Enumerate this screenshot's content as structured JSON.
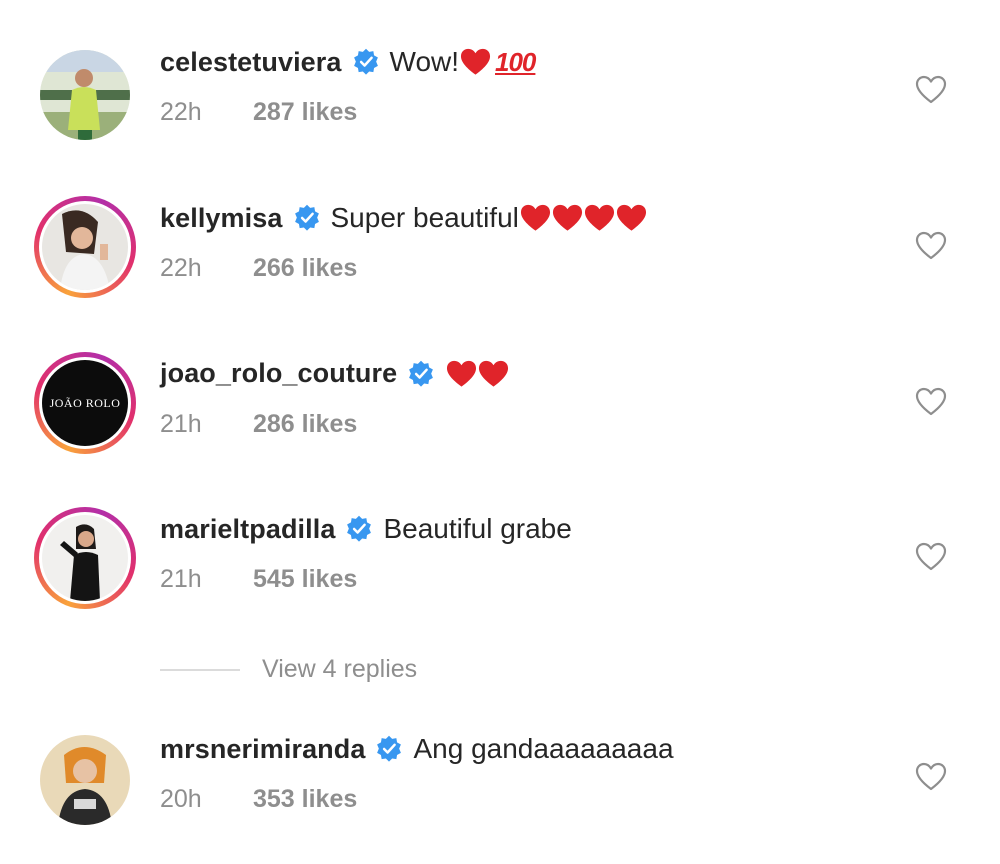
{
  "comments": [
    {
      "username": "celestetuviera",
      "text": "Wow! ",
      "emoji": [
        "heart"
      ],
      "extra": "100",
      "time": "22h",
      "likes": "287 likes"
    },
    {
      "username": "kellymisa",
      "text": "Super beautiful ",
      "emoji": [
        "heart",
        "heart",
        "heart",
        "heart"
      ],
      "time": "22h",
      "likes": "266 likes"
    },
    {
      "username": "joao_rolo_couture",
      "text": "",
      "emoji": [
        "heart",
        "heart"
      ],
      "time": "21h",
      "likes": "286 likes",
      "avatar_text": "JOÃO ROLO"
    },
    {
      "username": "marieltpadilla",
      "text": "Beautiful grabe",
      "emoji": [],
      "time": "21h",
      "likes": "545 likes"
    },
    {
      "username": "mrsnerimiranda",
      "text": "Ang gandaaaaaaaaa",
      "emoji": [],
      "time": "20h",
      "likes": "353 likes"
    }
  ],
  "view_replies": "View 4 replies",
  "colors": {
    "verified": "#3897f0",
    "heart": "#e0242a",
    "meta": "#8e8e8e"
  }
}
